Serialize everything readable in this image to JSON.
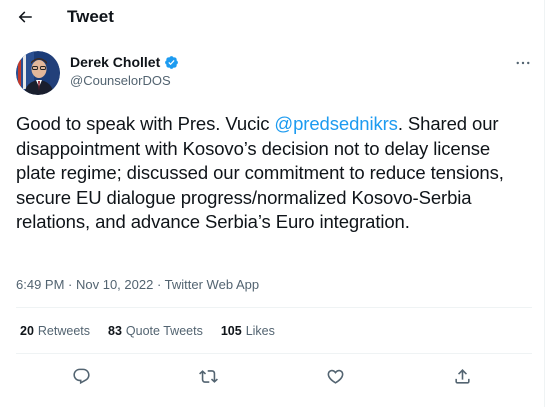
{
  "header": {
    "title": "Tweet"
  },
  "author": {
    "name": "Derek Chollet",
    "handle": "@CounselorDOS"
  },
  "tweet": {
    "text_before": "Good to speak with Pres. Vucic ",
    "mention": "@predsednikrs",
    "text_after": ". Shared our disappointment with Kosovo’s decision not to delay license plate regime; discussed our commitment to reduce tensions, secure EU dialogue progress/normalized Kosovo-Serbia relations, and advance Serbia’s Euro integration."
  },
  "meta": {
    "time": "6:49 PM",
    "separator1": " · ",
    "date": "Nov 10, 2022",
    "separator2": " · ",
    "source": "Twitter Web App"
  },
  "stats": {
    "retweets_count": "20",
    "retweets_label": "Retweets",
    "quotes_count": "83",
    "quotes_label": "Quote Tweets",
    "likes_count": "105",
    "likes_label": "Likes"
  },
  "icons": {
    "back": "arrow-left-icon",
    "verified": "verified-badge-icon",
    "more": "more-horizontal-icon",
    "reply": "reply-icon",
    "retweet": "retweet-icon",
    "like": "heart-icon",
    "share": "share-icon"
  },
  "colors": {
    "accent": "#1d9bf0",
    "text": "#0f1419",
    "muted": "#536471",
    "divider": "#eff3f4"
  }
}
